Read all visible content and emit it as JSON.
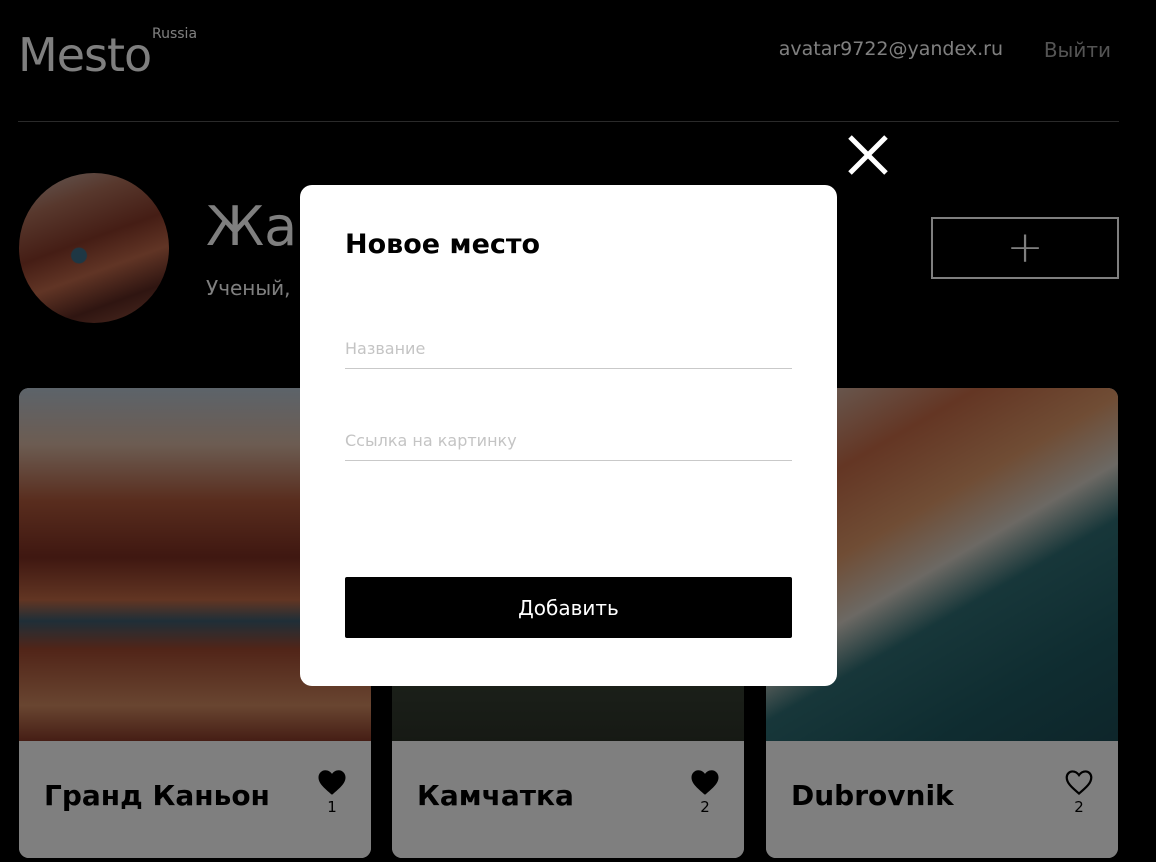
{
  "header": {
    "logo": "Mesto",
    "logo_sub": "Russia",
    "user_email": "avatar9722@yandex.ru",
    "logout_label": "Выйти"
  },
  "profile": {
    "name": "Жан",
    "about": "Ученый,",
    "add_button_label": "+"
  },
  "cards": [
    {
      "title": "Гранд Каньон",
      "likes": "1",
      "liked": true
    },
    {
      "title": "Камчатка",
      "likes": "2",
      "liked": true
    },
    {
      "title": "Dubrovnik",
      "likes": "2",
      "liked": false
    }
  ],
  "popup": {
    "title": "Новое место",
    "name_placeholder": "Название",
    "link_placeholder": "Ссылка на картинку",
    "submit_label": "Добавить"
  },
  "icons": {
    "close": "close-icon",
    "like_filled": "heart-filled-icon",
    "like_outline": "heart-outline-icon"
  }
}
